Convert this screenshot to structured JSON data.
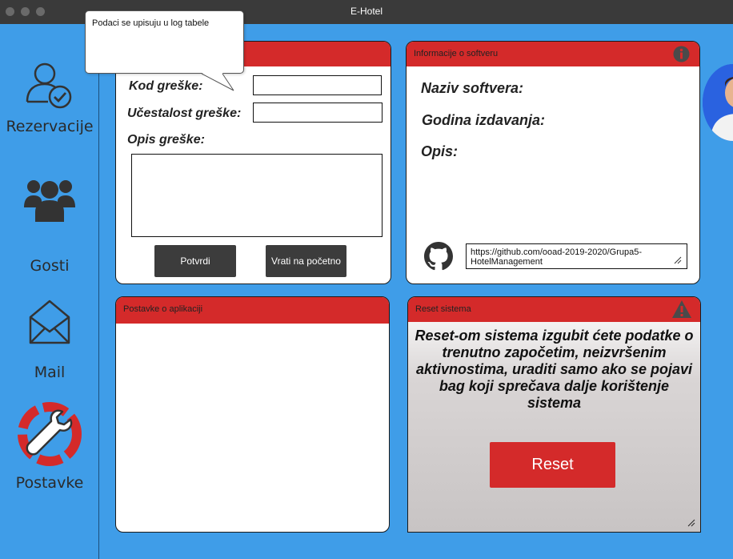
{
  "window": {
    "title": "E-Hotel"
  },
  "sidebar": {
    "items": [
      {
        "label": "Rezervacije",
        "icon": "user-check-icon"
      },
      {
        "label": "Gosti",
        "icon": "group-icon"
      },
      {
        "label": "Mail",
        "icon": "envelope-icon"
      },
      {
        "label": "Postavke",
        "icon": "wrench-settings-icon",
        "active": true
      }
    ]
  },
  "tooltip": {
    "text": "Podaci se upisuju u log tabele"
  },
  "error_form": {
    "code_label": "Kod greške:",
    "code_value": "",
    "frequency_label": "Učestalost greške:",
    "frequency_value": "",
    "description_label": "Opis greške:",
    "description_value": "",
    "confirm_label": "Potvrdi",
    "back_label": "Vrati na početno"
  },
  "software_info": {
    "header": "Informacije o softveru",
    "name_label": "Naziv softvera:",
    "year_label": "Godina izdavanja:",
    "description_label": "Opis:",
    "repo_url": "https://github.com/ooad-2019-2020/Grupa5-HotelManagement"
  },
  "app_settings": {
    "header": "Postavke o aplikaciji"
  },
  "reset_system": {
    "header": "Reset sistema",
    "warning": "Reset-om sistema izgubit ćete podatke o trenutno započetim, neizvršenim aktivnostima, uraditi samo ako se pojavi bag koji sprečava dalje korištenje sistema",
    "button_label": "Reset"
  },
  "colors": {
    "background": "#3f9de8",
    "accent_red": "#d42a2a",
    "dark_button": "#3c3c3c",
    "titlebar": "#3a3a3a"
  }
}
